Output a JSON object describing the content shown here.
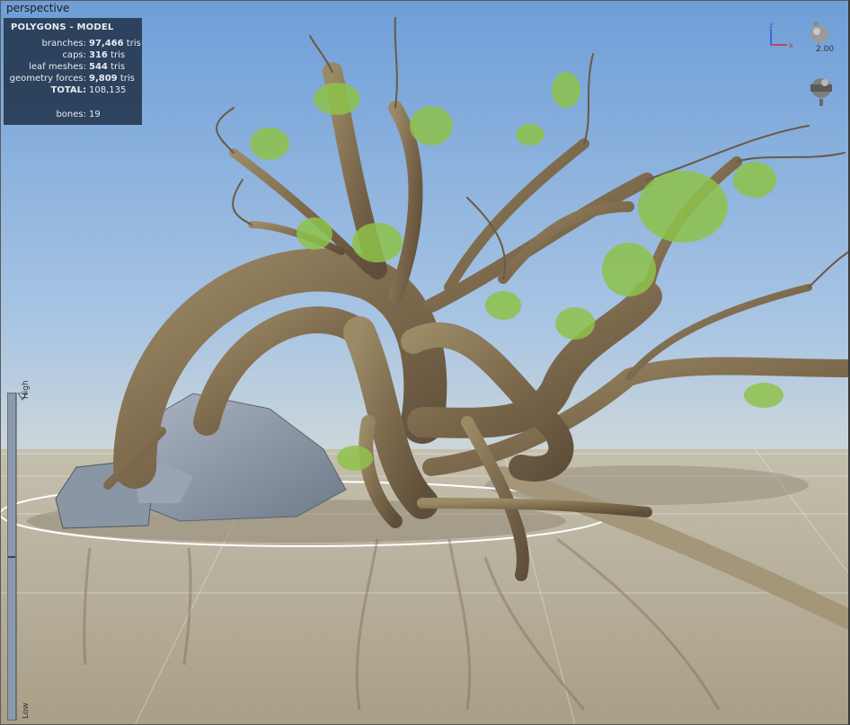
{
  "viewport": {
    "label": "perspective"
  },
  "stats": {
    "title": "POLYGONS - MODEL",
    "rows": [
      {
        "label": "branches:",
        "value": "97,466",
        "unit": "tris"
      },
      {
        "label": "caps:",
        "value": "316",
        "unit": "tris"
      },
      {
        "label": "leaf meshes:",
        "value": "544",
        "unit": "tris"
      },
      {
        "label": "geometry forces:",
        "value": "9,809",
        "unit": "tris"
      }
    ],
    "total_label": "TOTAL:",
    "total_value": "108,135",
    "bones_label": "bones:",
    "bones_value": "19"
  },
  "gizmo": {
    "z_label": "z",
    "x_label": "x",
    "zoom": "2.00",
    "icons": [
      "axis-gizmo-icon",
      "camera-icon",
      "render-mode-icon"
    ]
  },
  "lod": {
    "high_label": "High",
    "low_label": "Low"
  },
  "colors": {
    "sky_top": "#6f9fd9",
    "sky_bottom": "#cdd6da",
    "ground": "#b2aa93",
    "bark": "#8a7656",
    "leaves": "#8ec24a",
    "rock": "#8e9aa8",
    "panel": "#263a52"
  }
}
